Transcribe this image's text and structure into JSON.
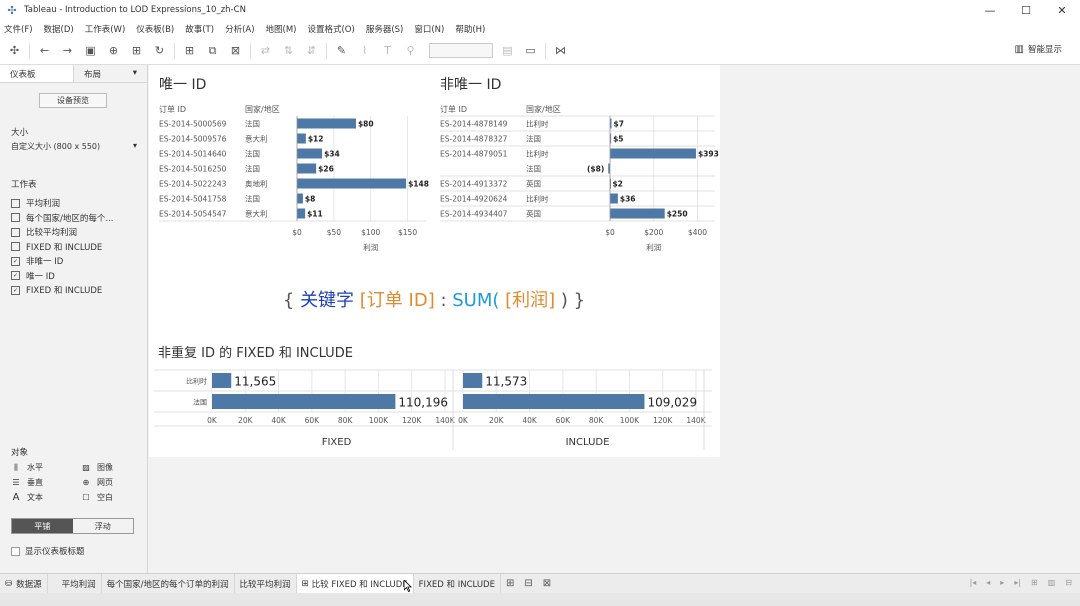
{
  "window": {
    "title": "Tableau - Introduction to LOD Expressions_10_zh-CN",
    "controls": [
      "minimize-icon",
      "maximize-icon",
      "close-icon"
    ]
  },
  "menu": [
    "文件(F)",
    "数据(D)",
    "工作表(W)",
    "仪表板(B)",
    "故事(T)",
    "分析(A)",
    "地图(M)",
    "设置格式(O)",
    "服务器(S)",
    "窗口(N)",
    "帮助(H)"
  ],
  "toolbar": {
    "smart_show": "智能显示"
  },
  "left_panel": {
    "tab_dashboard": "仪表板",
    "tab_layout": "布局",
    "tab_layout_arrow": "▾",
    "device_preview": "设备预览",
    "size_label": "大小",
    "size_value": "自定义大小 (800 x 550)",
    "size_arrow": "▾",
    "sheets_label": "工作表",
    "sheets": [
      "平均利润",
      "每个国家/地区的每个...",
      "比较平均利润",
      "FIXED 和 INCLUDE",
      "非唯一 ID",
      "唯一 ID",
      "FIXED 和 INCLUDE"
    ],
    "objects_label": "对象",
    "objects": [
      {
        "label": "水平",
        "icon": "horizontal-icon"
      },
      {
        "label": "图像",
        "icon": "image-icon"
      },
      {
        "label": "垂直",
        "icon": "vertical-icon"
      },
      {
        "label": "网页",
        "icon": "web-icon"
      },
      {
        "label": "文本",
        "icon": "text-icon"
      },
      {
        "label": "空白",
        "icon": "blank-icon"
      }
    ],
    "tiled": "平铺",
    "floating": "浮动",
    "show_title": "显示仪表板标题"
  },
  "unique": {
    "title": "唯一 ID",
    "col_order": "订单 ID",
    "col_country": "国家/地区",
    "rows": [
      {
        "order": "ES-2014-5000569",
        "country": "法国",
        "value": 80,
        "label": "$80"
      },
      {
        "order": "ES-2014-5009576",
        "country": "意大利",
        "value": 12,
        "label": "$12"
      },
      {
        "order": "ES-2014-5014640",
        "country": "法国",
        "value": 34,
        "label": "$34"
      },
      {
        "order": "ES-2014-5016250",
        "country": "法国",
        "value": 26,
        "label": "$26"
      },
      {
        "order": "ES-2014-5022243",
        "country": "奥地利",
        "value": 148,
        "label": "$148"
      },
      {
        "order": "ES-2014-5041758",
        "country": "法国",
        "value": 8,
        "label": "$8"
      },
      {
        "order": "ES-2014-5054547",
        "country": "意大利",
        "value": 11,
        "label": "$11"
      }
    ],
    "ticks": [
      "$0",
      "$50",
      "$100",
      "$150"
    ],
    "tick_values": [
      0,
      50,
      100,
      150
    ],
    "domain": [
      0,
      175
    ],
    "axis_title": "利润"
  },
  "nonunique": {
    "title": "非唯一 ID",
    "col_order": "订单 ID",
    "col_country": "国家/地区",
    "rows": [
      {
        "order": "ES-2014-4878149",
        "country": "比利时",
        "value": 7,
        "label": "$7",
        "group_start": true
      },
      {
        "order": "ES-2014-4878327",
        "country": "法国",
        "value": 5,
        "label": "$5",
        "group_start": true
      },
      {
        "order": "ES-2014-4879051",
        "country": "比利时",
        "value": 393,
        "label": "$393",
        "group_start": true
      },
      {
        "order": "",
        "country": "法国",
        "value": -8,
        "label": "($8)",
        "group_start": false
      },
      {
        "order": "ES-2014-4913372",
        "country": "英国",
        "value": 2,
        "label": "$2",
        "group_start": true
      },
      {
        "order": "ES-2014-4920624",
        "country": "比利时",
        "value": 36,
        "label": "$36",
        "group_start": true
      },
      {
        "order": "ES-2014-4934407",
        "country": "英国",
        "value": 250,
        "label": "$250",
        "group_start": true
      }
    ],
    "ticks": [
      "$0",
      "$200",
      "$400"
    ],
    "tick_values": [
      0,
      200,
      400
    ],
    "domain": [
      0,
      480
    ],
    "axis_title": "利润"
  },
  "formula": {
    "open": "{ ",
    "keyword": "关键字",
    "dim": " [订单 ID]",
    "colon": " : ",
    "func": "SUM(",
    "measure": " [利润] ",
    "close": ") }",
    "colors": {
      "brace": "#555555",
      "keyword": "#1f3fb8",
      "dim": "#e38a2e",
      "func": "#1e9ad6",
      "measure": "#e38a2e"
    }
  },
  "fixed_include": {
    "title": "非重复 ID 的 FIXED 和 INCLUDE",
    "row_labels": [
      "比利时",
      "法国"
    ],
    "ticks": [
      "0K",
      "20K",
      "40K",
      "60K",
      "80K",
      "100K",
      "120K",
      "140K"
    ],
    "tick_values": [
      0,
      20000,
      40000,
      60000,
      80000,
      100000,
      120000,
      140000
    ],
    "domain": [
      0,
      140000
    ],
    "fixed": {
      "name": "FIXED",
      "values": [
        11565,
        110196
      ],
      "labels": [
        "11,565",
        "110,196"
      ]
    },
    "include": {
      "name": "INCLUDE",
      "values": [
        11573,
        109029
      ],
      "labels": [
        "11,573",
        "109,029"
      ]
    }
  },
  "bottom_tabs": {
    "datasource": "数据源",
    "tabs": [
      "平均利润",
      "每个国家/地区的每个订单的利润",
      "比较平均利润",
      "比较 FIXED 和 INCLUDE",
      "FIXED 和 INCLUDE"
    ],
    "active_index": 3,
    "nav": [
      "|◂",
      "◂",
      "▸",
      "▸|",
      "⊞",
      "▥",
      "⊟"
    ]
  },
  "colors": {
    "bar": "#4e79a7",
    "grid": "#e6e6e6",
    "rule": "#d6d6d6"
  }
}
